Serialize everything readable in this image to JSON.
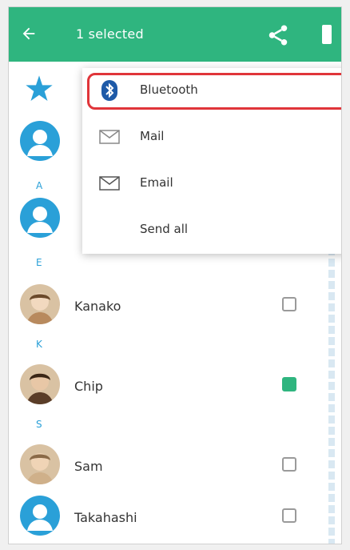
{
  "appbar": {
    "title": "1 selected",
    "back_icon": "arrow-left-icon",
    "share_icon": "share-icon",
    "more_icon": "overflow-menu-icon",
    "color": "#2fb57f"
  },
  "share_menu": {
    "items": [
      {
        "label": "Bluetooth",
        "icon": "bluetooth-icon",
        "highlighted": true
      },
      {
        "label": "Mail",
        "icon": "mail-icon",
        "highlighted": false
      },
      {
        "label": "Email",
        "icon": "email-icon",
        "highlighted": false
      },
      {
        "label": "Send all",
        "icon": "",
        "highlighted": false
      }
    ]
  },
  "contacts": [
    {
      "name": "Kanako",
      "checked": false,
      "avatar": "photo"
    },
    {
      "name": "Chip",
      "checked": true,
      "avatar": "photo"
    },
    {
      "name": "Sam",
      "checked": false,
      "avatar": "photo"
    },
    {
      "name": "Takahashi",
      "checked": false,
      "avatar": "default"
    }
  ],
  "index_letters": [
    "A",
    "E",
    "K",
    "S"
  ],
  "colors": {
    "accent": "#2fb57f",
    "avatar_blue": "#2aa0d8",
    "highlight": "#e0353a"
  }
}
